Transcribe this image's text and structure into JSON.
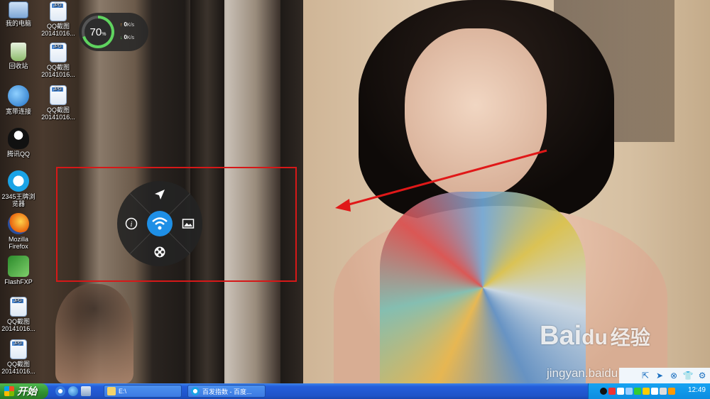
{
  "desktop_icons": [
    {
      "name": "my-computer",
      "label": "我的电脑",
      "icon": "computer-icon"
    },
    {
      "name": "qq-screenshot-1",
      "label": "QQ截图20141016...",
      "icon": "jpg-file-icon"
    },
    {
      "name": "recycle-bin",
      "label": "回收站",
      "icon": "recycle-bin-icon"
    },
    {
      "name": "qq-screenshot-2",
      "label": "QQ截图20141016...",
      "icon": "jpg-file-icon"
    },
    {
      "name": "broadband",
      "label": "宽带连接",
      "icon": "network-icon"
    },
    {
      "name": "qq-screenshot-3",
      "label": "QQ截图20141016...",
      "icon": "jpg-file-icon"
    },
    {
      "name": "tencent-qq",
      "label": "腾讯QQ",
      "icon": "qq-penguin-icon"
    },
    {
      "name": "browser-2345",
      "label": "2345王牌浏览器",
      "icon": "browser-icon"
    },
    {
      "name": "firefox",
      "label": "Mozilla Firefox",
      "icon": "firefox-icon"
    },
    {
      "name": "flashfxp",
      "label": "FlashFXP",
      "icon": "ftp-icon"
    },
    {
      "name": "qq-screenshot-4",
      "label": "QQ截图20141016...",
      "icon": "jpg-file-icon"
    },
    {
      "name": "qq-screenshot-5",
      "label": "QQ截图20141016...",
      "icon": "jpg-file-icon"
    }
  ],
  "speed_widget": {
    "percent": "70",
    "percent_unit": "%",
    "upload": "0",
    "download": "0",
    "rate_unit": "K/s",
    "ring_fraction": 0.7
  },
  "radial_menu": {
    "items": [
      "send-arrow-icon",
      "info-icon",
      "image-icon",
      "film-reel-icon"
    ],
    "center": "wifi-icon",
    "center_color": "#1e8fe6"
  },
  "watermark": {
    "logo": "Bai",
    "logo_suffix": "du",
    "brand_cn": "经验",
    "url": "jingyan.baidu.com"
  },
  "taskbar": {
    "start_label": "开始",
    "tasks": [
      {
        "label": "E:\\"
      },
      {
        "label": "百发指数 - 百度..."
      }
    ],
    "clock": "12:49"
  },
  "colors": {
    "highlight": "#d61818",
    "taskbar": "#245edb",
    "tray": "#0d8de0"
  }
}
